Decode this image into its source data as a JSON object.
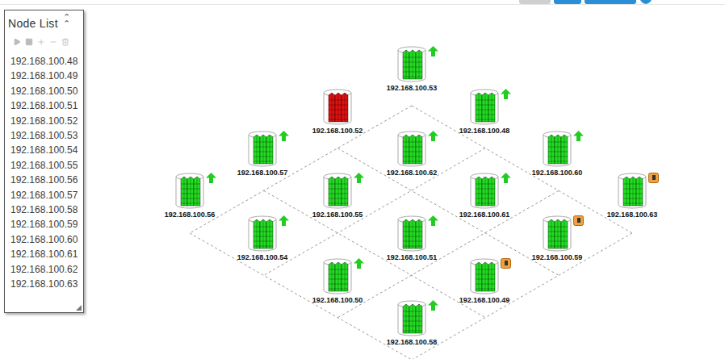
{
  "panel": {
    "title": "Node List",
    "collapse_icon": "⌃",
    "toolbar": [
      {
        "disabled": true
      },
      {
        "disabled": true
      },
      {
        "disabled": true
      },
      {
        "disabled": true
      },
      {
        "disabled": true
      }
    ],
    "items": [
      {
        "label": "192.168.100.48"
      },
      {
        "label": "192.168.100.49"
      },
      {
        "label": "192.168.100.50"
      },
      {
        "label": "192.168.100.51"
      },
      {
        "label": "192.168.100.52"
      },
      {
        "label": "192.168.100.53"
      },
      {
        "label": "192.168.100.54"
      },
      {
        "label": "192.168.100.55"
      },
      {
        "label": "192.168.100.56"
      },
      {
        "label": "192.168.100.57"
      },
      {
        "label": "192.168.100.58"
      },
      {
        "label": "192.168.100.59"
      },
      {
        "label": "192.168.100.60"
      },
      {
        "label": "192.168.100.61"
      },
      {
        "label": "192.168.100.62"
      },
      {
        "label": "192.168.100.63"
      }
    ]
  },
  "nodes": [
    {
      "label": "192.168.100.53",
      "status": "up",
      "color": "#22dd22"
    },
    {
      "label": "192.168.100.52",
      "status": "none",
      "color": "#e01010"
    },
    {
      "label": "192.168.100.48",
      "status": "up",
      "color": "#22dd22"
    },
    {
      "label": "192.168.100.57",
      "status": "up",
      "color": "#22dd22"
    },
    {
      "label": "192.168.100.62",
      "status": "up",
      "color": "#22dd22"
    },
    {
      "label": "192.168.100.60",
      "status": "up",
      "color": "#22dd22"
    },
    {
      "label": "192.168.100.56",
      "status": "up",
      "color": "#22dd22"
    },
    {
      "label": "192.168.100.55",
      "status": "up",
      "color": "#22dd22"
    },
    {
      "label": "192.168.100.61",
      "status": "up",
      "color": "#22dd22"
    },
    {
      "label": "192.168.100.63",
      "status": "warning",
      "color": "#22dd22"
    },
    {
      "label": "192.168.100.54",
      "status": "up",
      "color": "#22dd22"
    },
    {
      "label": "192.168.100.51",
      "status": "up",
      "color": "#22dd22"
    },
    {
      "label": "192.168.100.59",
      "status": "warning",
      "color": "#22dd22"
    },
    {
      "label": "192.168.100.50",
      "status": "up",
      "color": "#22dd22"
    },
    {
      "label": "192.168.100.49",
      "status": "warning",
      "color": "#22dd22"
    },
    {
      "label": "192.168.100.58",
      "status": "up",
      "color": "#22dd22"
    }
  ]
}
